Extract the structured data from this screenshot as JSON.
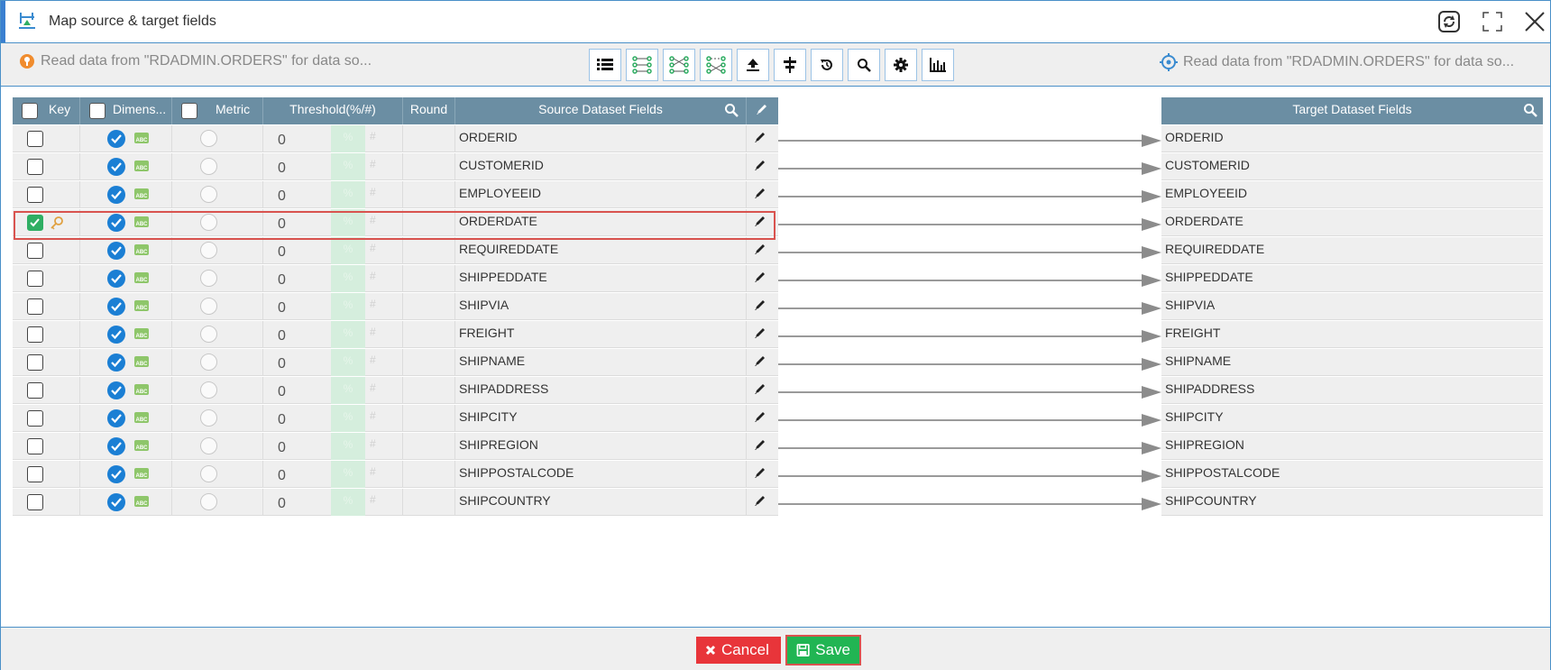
{
  "window": {
    "title": "Map source & target fields"
  },
  "toolbar": {
    "source_info": "Read data from \"RDADMIN.ORDERS\" for data so...",
    "target_info": "Read data from \"RDADMIN.ORDERS\" for data so...",
    "tools": [
      "list-icon",
      "map-all-icon",
      "map-by-name-icon",
      "map-by-position-icon",
      "upload-icon",
      "align-icon",
      "reset-icon",
      "search-icon",
      "settings-icon",
      "chart-icon"
    ]
  },
  "grid": {
    "headers": {
      "key": "Key",
      "dimension": "Dimens...",
      "metric": "Metric",
      "threshold": "Threshold(%/#)",
      "round": "Round",
      "source": "Source Dataset Fields",
      "target": "Target Dataset Fields"
    },
    "rows": [
      {
        "source": "ORDERID",
        "target": "ORDERID",
        "threshold": "0",
        "key": false,
        "pct": "%",
        "hash": "#"
      },
      {
        "source": "CUSTOMERID",
        "target": "CUSTOMERID",
        "threshold": "0",
        "key": false,
        "pct": "%",
        "hash": "#"
      },
      {
        "source": "EMPLOYEEID",
        "target": "EMPLOYEEID",
        "threshold": "0",
        "key": false,
        "pct": "%",
        "hash": "#"
      },
      {
        "source": "ORDERDATE",
        "target": "ORDERDATE",
        "threshold": "0",
        "key": true,
        "pct": "%",
        "hash": "#"
      },
      {
        "source": "REQUIREDDATE",
        "target": "REQUIREDDATE",
        "threshold": "0",
        "key": false,
        "pct": "%",
        "hash": "#"
      },
      {
        "source": "SHIPPEDDATE",
        "target": "SHIPPEDDATE",
        "threshold": "0",
        "key": false,
        "pct": "%",
        "hash": "#"
      },
      {
        "source": "SHIPVIA",
        "target": "SHIPVIA",
        "threshold": "0",
        "key": false,
        "pct": "%",
        "hash": "#"
      },
      {
        "source": "FREIGHT",
        "target": "FREIGHT",
        "threshold": "0",
        "key": false,
        "pct": "%",
        "hash": "#"
      },
      {
        "source": "SHIPNAME",
        "target": "SHIPNAME",
        "threshold": "0",
        "key": false,
        "pct": "%",
        "hash": "#"
      },
      {
        "source": "SHIPADDRESS",
        "target": "SHIPADDRESS",
        "threshold": "0",
        "key": false,
        "pct": "%",
        "hash": "#"
      },
      {
        "source": "SHIPCITY",
        "target": "SHIPCITY",
        "threshold": "0",
        "key": false,
        "pct": "%",
        "hash": "#"
      },
      {
        "source": "SHIPREGION",
        "target": "SHIPREGION",
        "threshold": "0",
        "key": false,
        "pct": "%",
        "hash": "#"
      },
      {
        "source": "SHIPPOSTALCODE",
        "target": "SHIPPOSTALCODE",
        "threshold": "0",
        "key": false,
        "pct": "%",
        "hash": "#"
      },
      {
        "source": "SHIPCOUNTRY",
        "target": "SHIPCOUNTRY",
        "threshold": "0",
        "key": false,
        "pct": "%",
        "hash": "#"
      }
    ]
  },
  "footer": {
    "cancel_label": "Cancel",
    "save_label": "Save"
  },
  "colors": {
    "accent": "#4a90c8",
    "header": "#6b8ea3",
    "cancel": "#e8353a",
    "save": "#21b553",
    "key_checked": "#2fae63",
    "dimension_checked": "#1b7fd4"
  }
}
